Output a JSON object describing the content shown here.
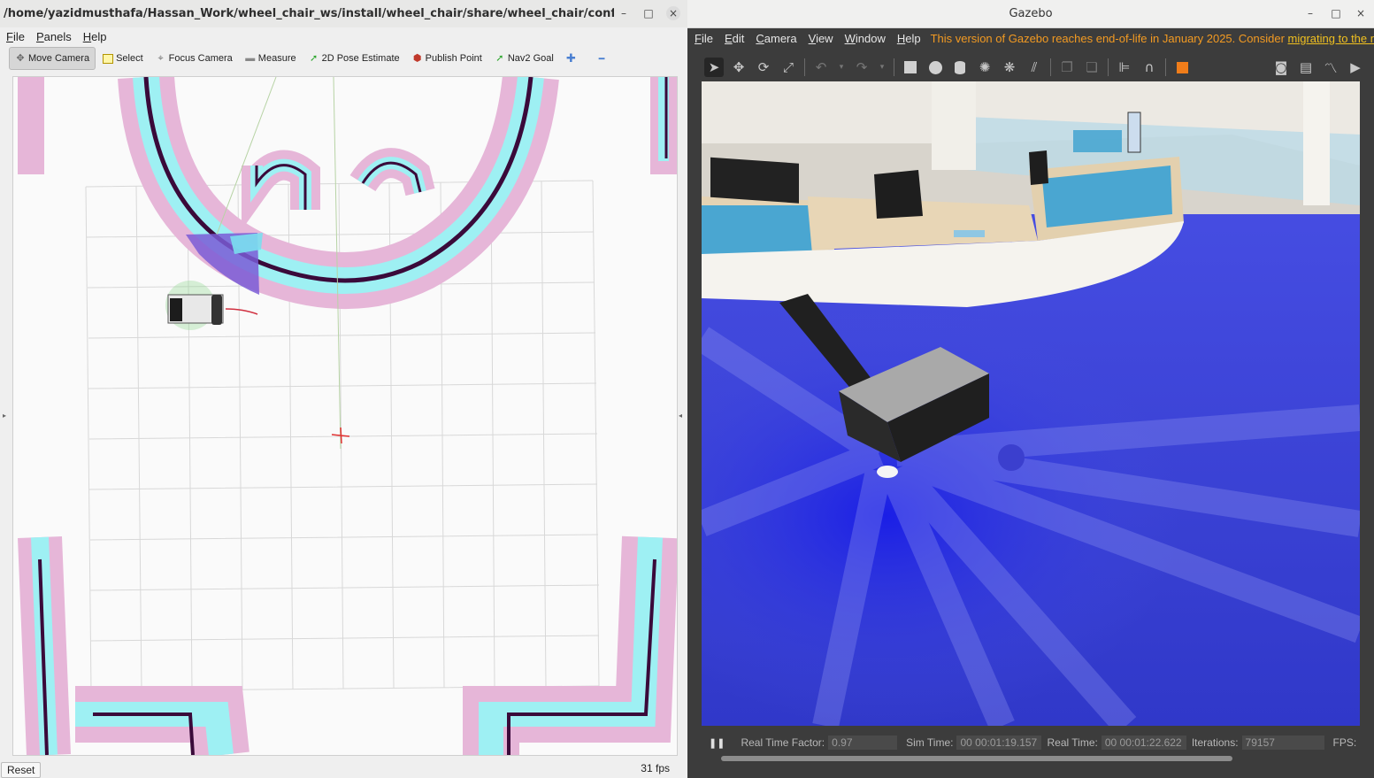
{
  "rviz": {
    "title": "/home/yazidmusthafa/Hassan_Work/wheel_chair_ws/install/wheel_chair/share/wheel_chair/config/navigation.rviz...",
    "window_controls": {
      "minimize": "–",
      "maximize": "□",
      "close": "×"
    },
    "menu": [
      {
        "label": "File",
        "accel": "F",
        "rest": "ile"
      },
      {
        "label": "Panels",
        "accel": "P",
        "rest": "anels"
      },
      {
        "label": "Help",
        "accel": "H",
        "rest": "elp"
      }
    ],
    "tools": [
      {
        "label": "Move Camera",
        "icon": "move-camera-icon",
        "glyph": "✥"
      },
      {
        "label": "Select",
        "icon": "select-icon",
        "glyph": "▭"
      },
      {
        "label": "Focus Camera",
        "icon": "focus-camera-icon",
        "glyph": "⌖"
      },
      {
        "label": "Measure",
        "icon": "measure-icon",
        "glyph": "▬"
      },
      {
        "label": "2D Pose Estimate",
        "icon": "pose-estimate-icon",
        "glyph": "➚"
      },
      {
        "label": "Publish Point",
        "icon": "publish-point-icon",
        "glyph": "⬢"
      },
      {
        "label": "Nav2 Goal",
        "icon": "nav2-goal-icon",
        "glyph": "➚"
      }
    ],
    "add_tool_glyph": "✚",
    "remove_tool_glyph": "━",
    "reset_label": "Reset",
    "fps": "31 fps",
    "splitter_glyph": "▸",
    "splitter_right_glyph": "◂"
  },
  "gazebo": {
    "title": "Gazebo",
    "window_controls": {
      "minimize": "–",
      "maximize": "□",
      "close": "×"
    },
    "menu": [
      {
        "label": "File",
        "accel": "F",
        "rest": "ile"
      },
      {
        "label": "Edit",
        "accel": "E",
        "rest": "dit"
      },
      {
        "label": "Camera",
        "accel": "C",
        "rest": "amera"
      },
      {
        "label": "View",
        "accel": "V",
        "rest": "iew"
      },
      {
        "label": "Window",
        "accel": "W",
        "rest": "indow"
      },
      {
        "label": "Help",
        "accel": "H",
        "rest": "elp"
      }
    ],
    "eol_notice": "This version of Gazebo reaches end-of-life in January 2025. Consider",
    "eol_link": "migrating to the n",
    "status": {
      "real_time_factor_label": "Real Time Factor:",
      "real_time_factor": "0.97",
      "sim_time_label": "Sim Time:",
      "sim_time": "00 00:01:19.157",
      "real_time_label": "Real Time:",
      "real_time": "00 00:01:22.622",
      "iterations_label": "Iterations:",
      "iterations": "79157",
      "fps_label": "FPS:"
    },
    "pause_glyph": "❚❚"
  }
}
